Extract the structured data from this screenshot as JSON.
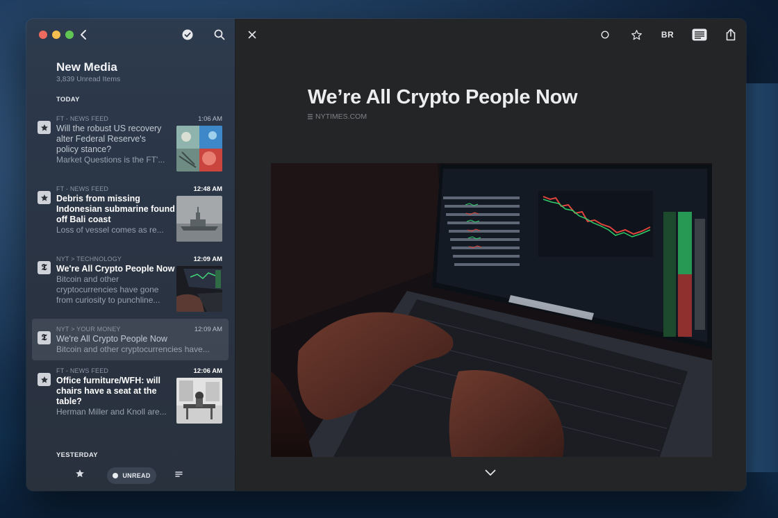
{
  "feed": {
    "title": "New Media",
    "subtitle": "3,839 Unread Items"
  },
  "sections": {
    "today": "TODAY",
    "yesterday": "YESTERDAY"
  },
  "articles": [
    {
      "source": "FT - NEWS FEED",
      "time": "1:06 AM",
      "title_lines": [
        "Will the robust US recovery",
        "alter Federal Reserve's",
        "policy stance?"
      ],
      "summary_lines": [
        "Market Questions is the FT'..."
      ],
      "favicon": "star-icon",
      "unread": false,
      "thumbnail": "collage-illustration"
    },
    {
      "source": "FT - NEWS FEED",
      "time": "12:48 AM",
      "title_lines": [
        "Debris from missing",
        "Indonesian submarine found",
        "off Bali coast"
      ],
      "summary_lines": [
        "Loss of vessel comes as re..."
      ],
      "favicon": "star-icon",
      "unread": true,
      "thumbnail": "warship-photo"
    },
    {
      "source": "NYT > TECHNOLOGY",
      "time": "12:09 AM",
      "title_lines": [
        "We're All Crypto People Now"
      ],
      "summary_lines": [
        "Bitcoin and other",
        "cryptocurrencies have gone",
        "from curiosity to punchline..."
      ],
      "favicon": "nyt-logo",
      "unread": true,
      "thumbnail": "laptop-trading-photo"
    },
    {
      "source": "NYT > YOUR MONEY",
      "time": "12:09 AM",
      "title_lines": [
        "We're All Crypto People Now"
      ],
      "summary_lines": [
        "Bitcoin and other cryptocurrencies have..."
      ],
      "favicon": "nyt-logo",
      "unread": false,
      "selected": true
    },
    {
      "source": "FT - NEWS FEED",
      "time": "12:06 AM",
      "title_lines": [
        "Office furniture/WFH: will",
        "chairs have a seat at the",
        "table?"
      ],
      "summary_lines": [
        "Herman Miller and Knoll are..."
      ],
      "favicon": "star-icon",
      "unread": true,
      "thumbnail": "office-bw-photo"
    }
  ],
  "bottom_bar": {
    "filter_label": "UNREAD"
  },
  "reader": {
    "headline": "We’re All Crypto People Now",
    "source": "NYTIMES.COM",
    "toolbar": {
      "br_label": "BR"
    },
    "hero_image": "person-typing-on-laptop-with-crypto-charts"
  },
  "colors": {
    "sidebar_bg": "#2a3444",
    "reader_bg": "#242527",
    "selected_row": "#3a4250",
    "chart_green": "#2fd06a",
    "chart_red": "#e0443c"
  }
}
